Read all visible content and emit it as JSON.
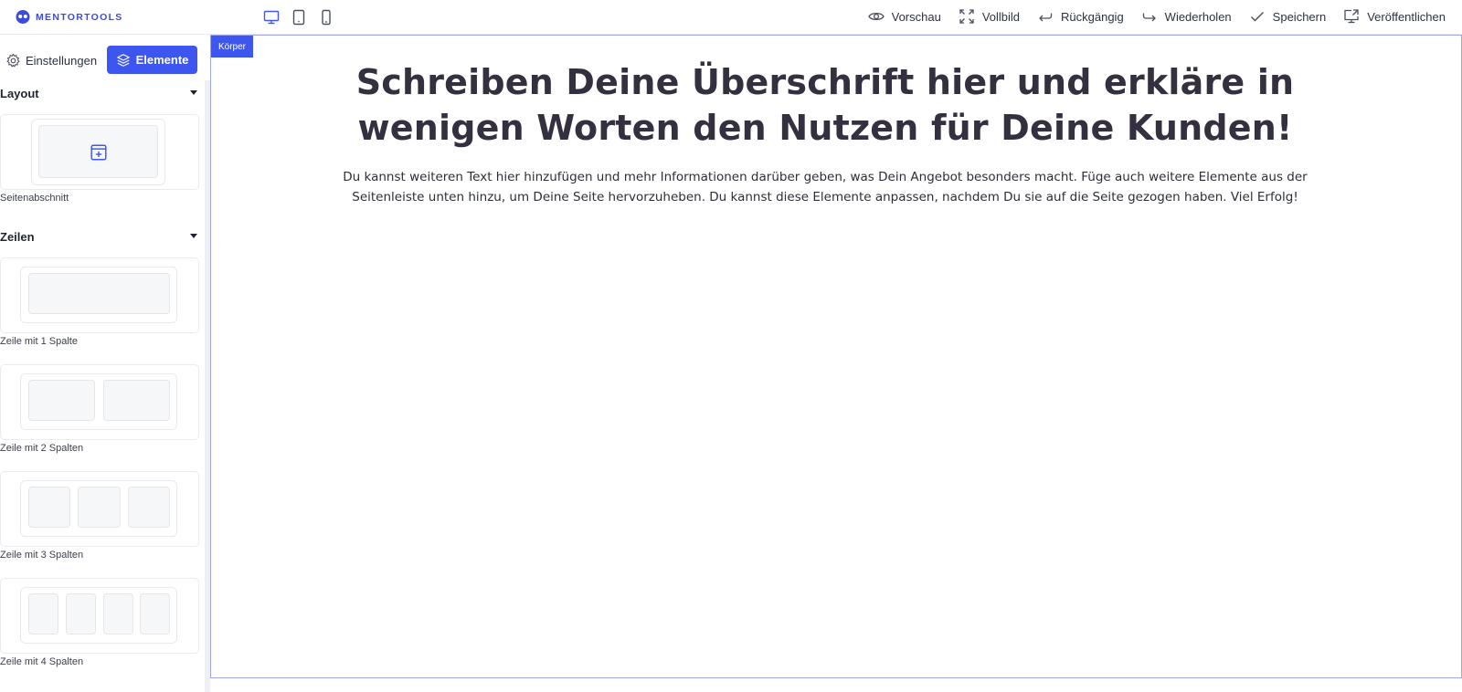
{
  "app": {
    "logo_text": "MENTORTOOLS",
    "accent_color": "#3e56f0"
  },
  "devices": [
    {
      "name": "desktop",
      "icon": "monitor-icon",
      "active": true
    },
    {
      "name": "tablet",
      "icon": "tablet-icon",
      "active": false
    },
    {
      "name": "mobile",
      "icon": "phone-icon",
      "active": false
    }
  ],
  "toolbar": {
    "preview_label": "Vorschau",
    "fullscreen_label": "Vollbild",
    "undo_label": "Rückgängig",
    "redo_label": "Wiederholen",
    "save_label": "Speichern",
    "publish_label": "Veröffentlichen"
  },
  "sidebar": {
    "tabs": {
      "settings_label": "Einstellungen",
      "elements_label": "Elemente"
    },
    "sections": [
      {
        "title": "Layout",
        "items": [
          {
            "label": "Seitenabschnitt",
            "icon": "section-add-icon"
          }
        ]
      },
      {
        "title": "Zeilen",
        "items": [
          {
            "label": "Zeile mit 1 Spalte",
            "columns": 1
          },
          {
            "label": "Zeile mit 2 Spalten",
            "columns": 2
          },
          {
            "label": "Zeile mit 3 Spalten",
            "columns": 3
          },
          {
            "label": "Zeile mit 4 Spalten",
            "columns": 4
          }
        ]
      }
    ]
  },
  "canvas": {
    "badge": "Körper",
    "headline": "Schreiben Deine Überschrift hier und erkläre in wenigen Worten den Nutzen für Deine Kunden!",
    "body": "Du kannst weiteren Text hier hinzufügen und mehr Informationen darüber geben, was Dein Angebot besonders macht. Füge auch weitere Elemente aus der Seitenleiste unten hinzu, um Deine Seite hervorzuheben. Du kannst diese Elemente anpassen, nachdem Du sie auf die Seite gezogen haben. Viel Erfolg!"
  }
}
